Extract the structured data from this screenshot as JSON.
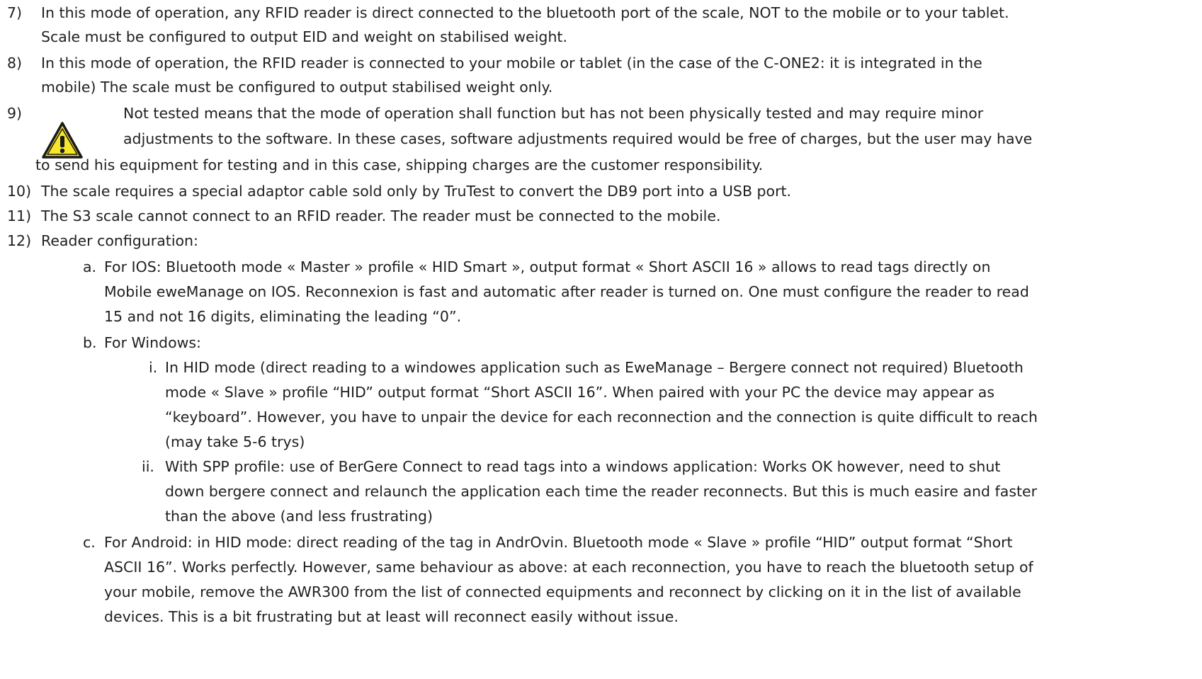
{
  "items": [
    {
      "num": "7)",
      "lines": [
        "In this mode of operation, any RFID reader is direct connected to the bluetooth port of the scale, NOT to the mobile or to your tablet.",
        "Scale must be configured to output EID and weight on stabilised weight."
      ]
    },
    {
      "num": "8)",
      "lines": [
        "In this mode of operation, the RFID reader is connected to your mobile or tablet (in the case of the C-ONE2: it is integrated in the",
        "mobile) The scale must be configured to output stabilised weight only."
      ]
    },
    {
      "num": "9)",
      "icon": "warning-triangle-icon",
      "lines": [
        "Not tested means that the mode of operation shall function but has not been physically tested and may require minor",
        "adjustments to the software. In these cases, software adjustments required would be free of charges, but the user may have",
        "to send his equipment for testing and in this case, shipping charges are the customer responsibility."
      ]
    },
    {
      "num": "10)",
      "lines": [
        "The scale requires a special adaptor cable sold only by TruTest to convert the DB9 port into a USB port."
      ]
    },
    {
      "num": "11)",
      "lines": [
        "The S3 scale cannot connect to an RFID reader. The reader must be connected to the mobile."
      ]
    },
    {
      "num": "12)",
      "lines": [
        "Reader configuration:"
      ]
    }
  ],
  "sub_items": [
    {
      "num": "a.",
      "lines": [
        "For IOS: Bluetooth mode « Master »  profile « HID Smart », output format « Short ASCII 16 » allows to read tags directly on",
        "Mobile eweManage on IOS. Reconnexion is fast and automatic after reader is turned on. One must configure the reader to read",
        "15 and not 16 digits, eliminating the leading “0”."
      ]
    },
    {
      "num": "b.",
      "lines": [
        "For Windows:"
      ]
    },
    {
      "num": "i.",
      "lines": [
        "In HID mode (direct reading to a windowes application such as EweManage – Bergere connect not required) Bluetooth",
        "mode « Slave » profile “HID” output format “Short ASCII 16”. When paired with your PC the device may appear as",
        "“keyboard”. However, you have to unpair the device for each reconnection and the connection is quite difficult to reach",
        "(may take 5-6 trys)"
      ]
    },
    {
      "num": "ii.",
      "lines": [
        "With SPP profile: use of BerGere Connect to read tags into a windows application: Works OK however, need to shut",
        "down bergere connect and relaunch the application each time the reader reconnects. But this is much easire and faster",
        "than the above (and less frustrating)"
      ]
    },
    {
      "num": "c.",
      "lines": [
        "For Android: in HID mode: direct reading of the tag in AndrOvin. Bluetooth mode « Slave » profile “HID” output format “Short",
        "ASCII 16”. Works perfectly. However, same behaviour as above: at each reconnection, you have to reach the bluetooth setup of",
        "your mobile, remove the AWR300 from the list of connected equipments and reconnect by clicking on it in the list of available",
        "devices. This is a bit frustrating but at least will reconnect easily without issue."
      ]
    }
  ],
  "colors": {
    "text": "#1f1f1f",
    "warning_fill": "#f7e62a",
    "warning_stroke": "#1a1a1a"
  }
}
